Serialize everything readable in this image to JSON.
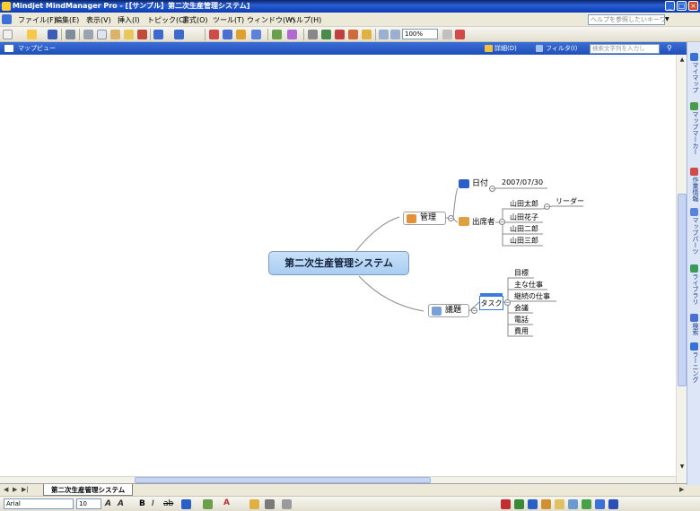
{
  "window": {
    "title": "Mindjet MindManager Pro - [【サンプル】第二次生産管理システム]",
    "help_placeholder": "ヘルプを参照したいキーワード"
  },
  "menu": [
    {
      "label": "ファイル(F)"
    },
    {
      "label": "編集(E)"
    },
    {
      "label": "表示(V)"
    },
    {
      "label": "挿入(I)"
    },
    {
      "label": "トピック(C)"
    },
    {
      "label": "書式(O)"
    },
    {
      "label": "ツール(T)"
    },
    {
      "label": "ウィンドウ(W)"
    },
    {
      "label": "ヘルプ(H)"
    }
  ],
  "toolbar": {
    "zoom": "100%"
  },
  "viewbar": {
    "view_label": "マップビュー",
    "detail_label": "詳細(D)",
    "filter_label": "フィルタ(I)",
    "search_placeholder": "検索文字列を入力し"
  },
  "taskpane": [
    {
      "label": "マイマップ",
      "icon": "mymap-icon"
    },
    {
      "label": "マップマーカー",
      "icon": "marker-icon"
    },
    {
      "label": "作業情報",
      "icon": "task-info-icon"
    },
    {
      "label": "マップパーツ",
      "icon": "map-parts-icon"
    },
    {
      "label": "ライブラリ",
      "icon": "library-icon"
    },
    {
      "label": "検索",
      "icon": "search-icon"
    },
    {
      "label": "ラーニング",
      "icon": "learning-icon"
    }
  ],
  "map": {
    "central": "第二次生産管理システム",
    "kanri": {
      "label": "管理",
      "date_label": "日付",
      "date_value": "2007/07/30",
      "attendees_label": "出席者",
      "attendees": [
        "山田太郎",
        "山田花子",
        "山田二郎",
        "山田三郎"
      ],
      "leader_label": "リーダー"
    },
    "gidai": {
      "label": "議題",
      "task_label": "タスク",
      "items": [
        "目標",
        "主な仕事",
        "継続の仕事",
        "会議",
        "電話",
        "費用"
      ]
    }
  },
  "tabs": {
    "sheet": "第二次生産管理システム"
  },
  "format": {
    "font": "Arial",
    "size": "10"
  }
}
